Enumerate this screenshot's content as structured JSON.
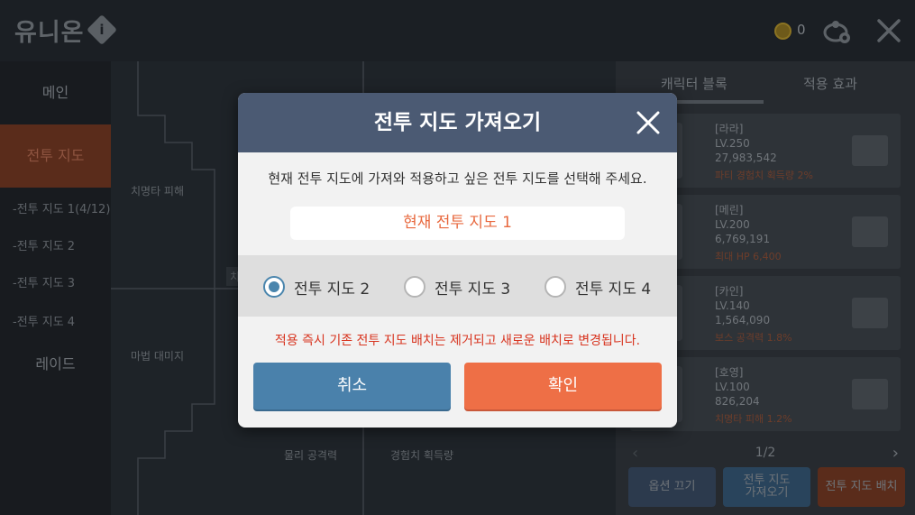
{
  "header": {
    "title": "유니온",
    "info_icon_text": "i",
    "coin_count": "0"
  },
  "sidebar": {
    "main_label": "메인",
    "battle_map_label": "전투 지도",
    "maps": [
      "-전투 지도 1(4/12)",
      "-전투 지도 2",
      "-전투 지도 3",
      "-전투 지도 4"
    ],
    "raid_label": "레이드"
  },
  "board": {
    "labels": [
      "치명타 피해",
      "마법 대미지",
      "물리 공격력",
      "경험치 획득량",
      "치"
    ]
  },
  "right_panel": {
    "tabs": [
      "캐릭터 블록",
      "적용 효과"
    ],
    "cards": [
      {
        "name": "[라라]",
        "level": "LV.250",
        "power": "27,983,542",
        "effect": "파티 경험치 획득량 2%"
      },
      {
        "name": "[메린]",
        "level": "LV.200",
        "power": "6,769,191",
        "effect": "최대 HP 6,400"
      },
      {
        "name": "[카인]",
        "level": "LV.140",
        "power": "1,564,090",
        "effect": "보스 공격력 1.8%"
      },
      {
        "name": "[호영]",
        "level": "LV.100",
        "power": "826,204",
        "effect": "치명타 피해 1.2%"
      }
    ],
    "page": "1/2",
    "prev": "‹",
    "next": "›",
    "buttons": {
      "options_off": "옵션 끄기",
      "import_map_line1": "전투 지도",
      "import_map_line2": "가져오기",
      "place_map": "전투 지도 배치"
    }
  },
  "dialog": {
    "title": "전투 지도 가져오기",
    "description": "현재 전투 지도에 가져와 적용하고 싶은 전투 지도를 선택해 주세요.",
    "current_map": "현재 전투 지도 1",
    "options": [
      {
        "label": "전투 지도 2",
        "selected": true
      },
      {
        "label": "전투 지도 3",
        "selected": false
      },
      {
        "label": "전투 지도 4",
        "selected": false
      }
    ],
    "warning": "적용 즉시 기존 전투 지도 배치는 제거되고 새로운 배치로 변경됩니다.",
    "cancel_label": "취소",
    "confirm_label": "확인"
  },
  "colors": {
    "dialog_header": "#4b5a73",
    "accent_orange": "#ee6f46",
    "accent_blue": "#4a81ab",
    "warning_red": "#d8341f",
    "current_map_text": "#e8693f"
  }
}
